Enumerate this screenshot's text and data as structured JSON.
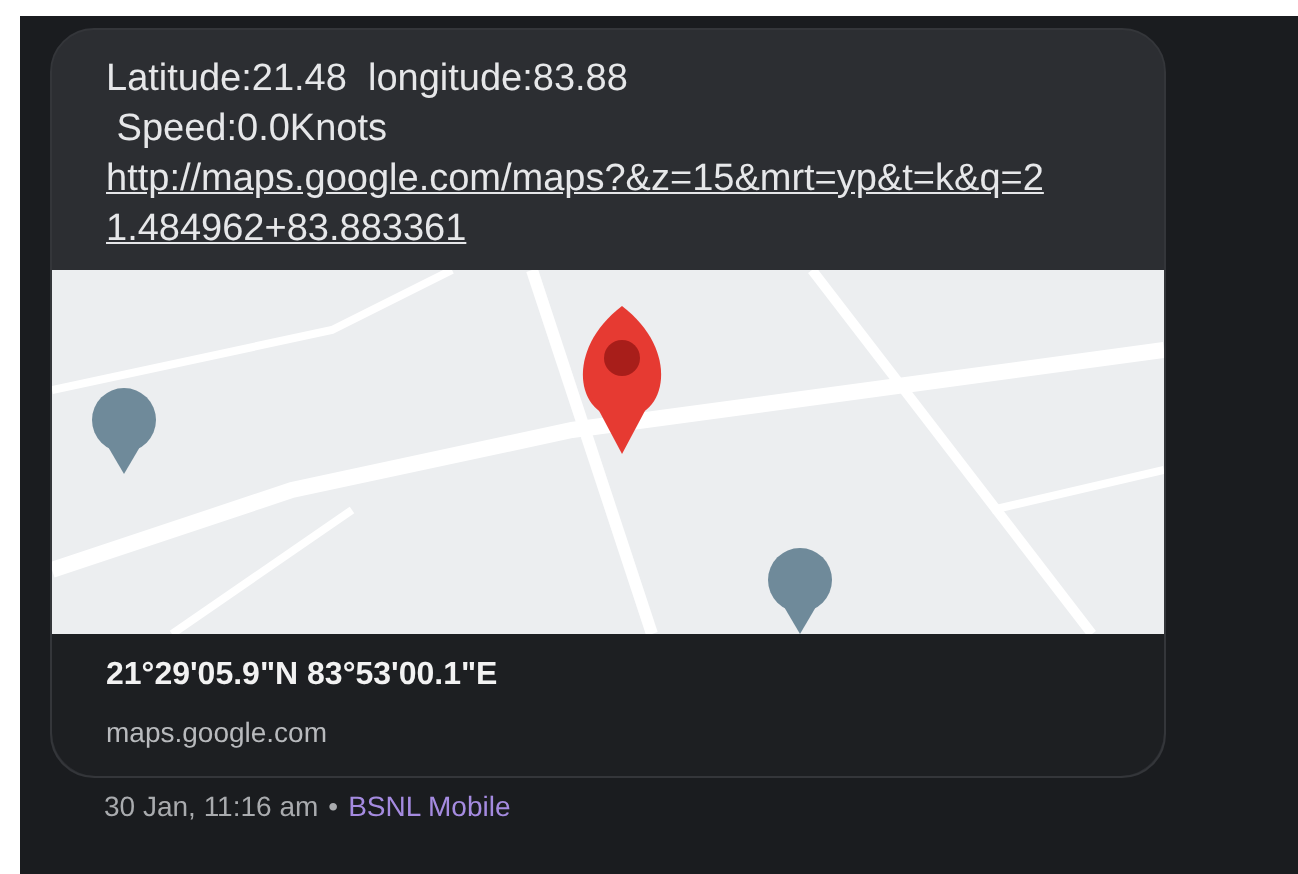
{
  "message": {
    "text": "Latitude:21.48  longitude:83.88\n Speed:0.0Knots ",
    "link": "http://maps.google.com/maps?&z=15&mrt=yp&t=k&q=21.484962+83.883361"
  },
  "preview": {
    "title": "21°29'05.9\"N 83°53'00.1\"E",
    "domain": "maps.google.com"
  },
  "meta": {
    "time": "30 Jan, 11:16 am",
    "separator": "•",
    "sim": "BSNL Mobile"
  }
}
